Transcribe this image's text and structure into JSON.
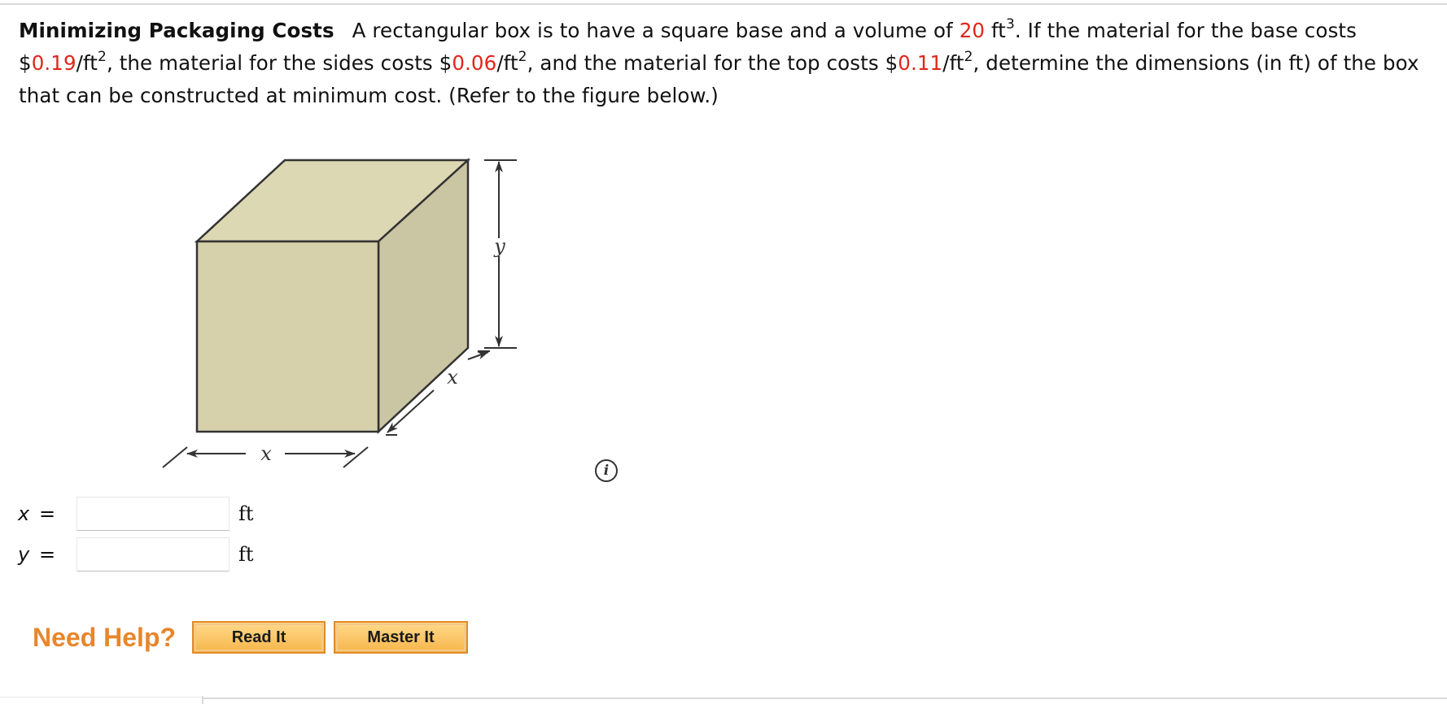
{
  "question": {
    "title": "Minimizing Packaging Costs",
    "part1": "A rectangular box is to have a square base and a volume of ",
    "volume_value": "20",
    "volume_unit": " ft",
    "volume_exp": "3",
    "part2": ". If the material for the base costs $",
    "base_cost": "0.19",
    "per_ft": "/ft",
    "sq_exp": "2",
    "part3": ", the material for the sides costs $",
    "side_cost": "0.06",
    "part4": ", and the material for the top costs $",
    "top_cost": "0.11",
    "part5": ", determine the dimensions (in ft) of the box that can be constructed at minimum cost. (Refer to the figure below.)"
  },
  "figure": {
    "label_height": "y",
    "label_depth": "x",
    "label_width": "x",
    "colors": {
      "top_face": "#ddd8b4",
      "front_face": "#d6d1ab",
      "side_face": "#cac5a2",
      "outline": "#333333"
    }
  },
  "info_icon": {
    "glyph": "i"
  },
  "answers": [
    {
      "variable": "x",
      "equals": "=",
      "value": "",
      "unit": "ft"
    },
    {
      "variable": "y",
      "equals": "=",
      "value": "",
      "unit": "ft"
    }
  ],
  "help": {
    "label": "Need Help?",
    "read_it": "Read It",
    "master_it": "Master It"
  }
}
